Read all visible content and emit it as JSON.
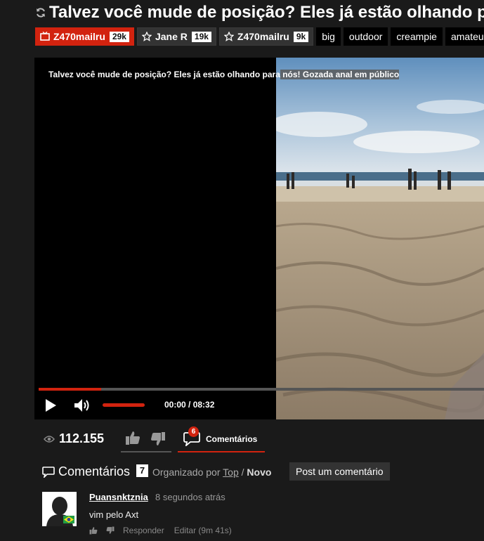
{
  "page": {
    "title": "Talvez você mude de posição? Eles já estão olhando para nós! Gozada anal em público"
  },
  "tags": [
    {
      "label": "Z470mailru",
      "count": "29k",
      "icon": "tv-icon",
      "style": "red"
    },
    {
      "label": "Jane R",
      "count": "19k",
      "icon": "star-icon",
      "style": "dark"
    },
    {
      "label": "Z470mailru",
      "count": "9k",
      "icon": "star-icon",
      "style": "dark"
    },
    {
      "label": "big"
    },
    {
      "label": "outdoor"
    },
    {
      "label": "creampie"
    },
    {
      "label": "amateur"
    }
  ],
  "video": {
    "overlay_title_part1": "Talvez você mude de posição? Eles já estão olhando para",
    "overlay_title_part2": " nós! Gozada anal em público",
    "time_current": "00:00",
    "time_total": "08:32",
    "timecode": "00:00 / 08:32",
    "progress_buffered": 0.14,
    "volume": 1.0
  },
  "stats": {
    "views": "112.155",
    "comments_count_badge": "6",
    "comments_tab_label": "Comentários"
  },
  "comments_section": {
    "heading": "Comentários",
    "count": "7",
    "sort_prefix": "Organizado por",
    "sort_top": "Top",
    "sort_sep": " / ",
    "sort_new": "Novo",
    "post_button": "Post um comentário"
  },
  "comments": [
    {
      "author": "Puansnktznia",
      "time": "8 segundos atrás",
      "text": "vim pelo Axt",
      "reply": "Responder",
      "edit": "Editar (9m 41s)"
    }
  ],
  "colors": {
    "accent": "#d2230f",
    "background": "#1a1a1a",
    "tag_bg": "#333333"
  }
}
